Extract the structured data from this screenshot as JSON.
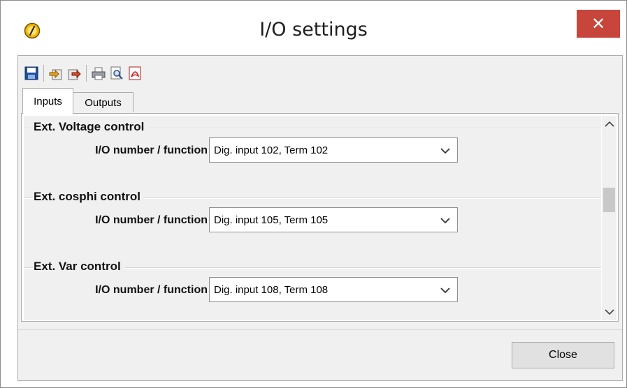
{
  "window": {
    "title": "I/O settings",
    "close_glyph": "✕",
    "app_icon": "settings-app-icon"
  },
  "toolbar": {
    "icons": [
      "save-icon",
      "import-icon",
      "export-icon",
      "print-icon",
      "print-preview-icon",
      "pdf-icon"
    ]
  },
  "tabs": [
    {
      "label": "Inputs",
      "selected": true
    },
    {
      "label": "Outputs",
      "selected": false
    }
  ],
  "groups": [
    {
      "title": "Ext. Voltage control",
      "field_label": "I/O number / function",
      "value": "Dig. input 102, Term 102"
    },
    {
      "title": "Ext. cosphi control",
      "field_label": "I/O number / function",
      "value": "Dig. input 105, Term 105"
    },
    {
      "title": "Ext. Var control",
      "field_label": "I/O number / function",
      "value": "Dig. input 108, Term 108"
    }
  ],
  "footer": {
    "close_label": "Close"
  },
  "colors": {
    "close_button_bg": "#c7453a",
    "panel_bg": "#f0f0f0"
  }
}
